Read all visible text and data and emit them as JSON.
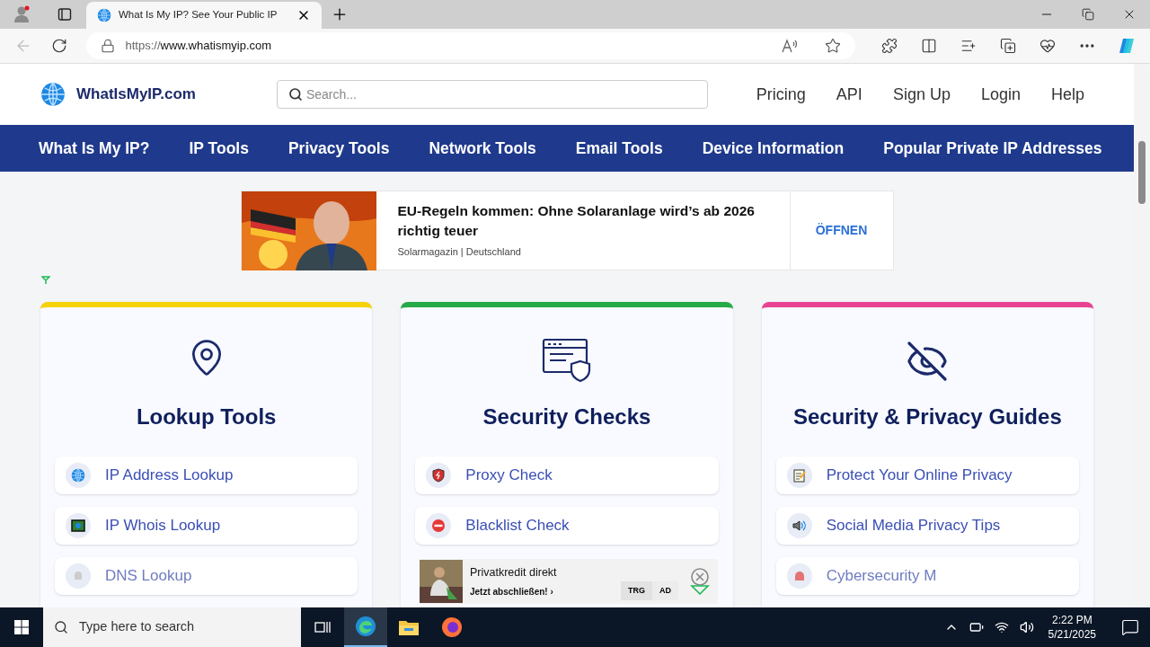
{
  "browser": {
    "tab_title": "What Is My IP? See Your Public IP",
    "url_scheme": "https://",
    "url_host": "www.whatismyip.com"
  },
  "header": {
    "logo": "WhatIsMyIP.com",
    "search_placeholder": "Search...",
    "links": [
      "Pricing",
      "API",
      "Sign Up",
      "Login",
      "Help"
    ]
  },
  "nav": [
    "What Is My IP?",
    "IP Tools",
    "Privacy Tools",
    "Network Tools",
    "Email Tools",
    "Device Information",
    "Popular Private IP Addresses"
  ],
  "ad": {
    "headline": "EU-Regeln kommen: Ohne Solaranlage wird’s ab 2026 richtig teuer",
    "source": "Solarmagazin | Deutschland",
    "button": "ÖFFNEN"
  },
  "cards": [
    {
      "title": "Lookup Tools",
      "color": "#f5d20a",
      "items": [
        "IP Address Lookup",
        "IP Whois Lookup",
        "DNS Lookup"
      ]
    },
    {
      "title": "Security Checks",
      "color": "#26a947",
      "items": [
        "Proxy Check",
        "Blacklist Check"
      ]
    },
    {
      "title": "Security & Privacy Guides",
      "color": "#e84393",
      "items": [
        "Protect Your Online Privacy",
        "Social Media Privacy Tips",
        "Cybersecurity M"
      ]
    }
  ],
  "bottom_ad": {
    "title": "Privatkredit direkt",
    "subtitle": "Jetzt abschließen! ›",
    "tags": [
      "TRG",
      "AD"
    ]
  },
  "taskbar": {
    "search_placeholder": "Type here to search",
    "time": "2:22 PM",
    "date": "5/21/2025"
  }
}
